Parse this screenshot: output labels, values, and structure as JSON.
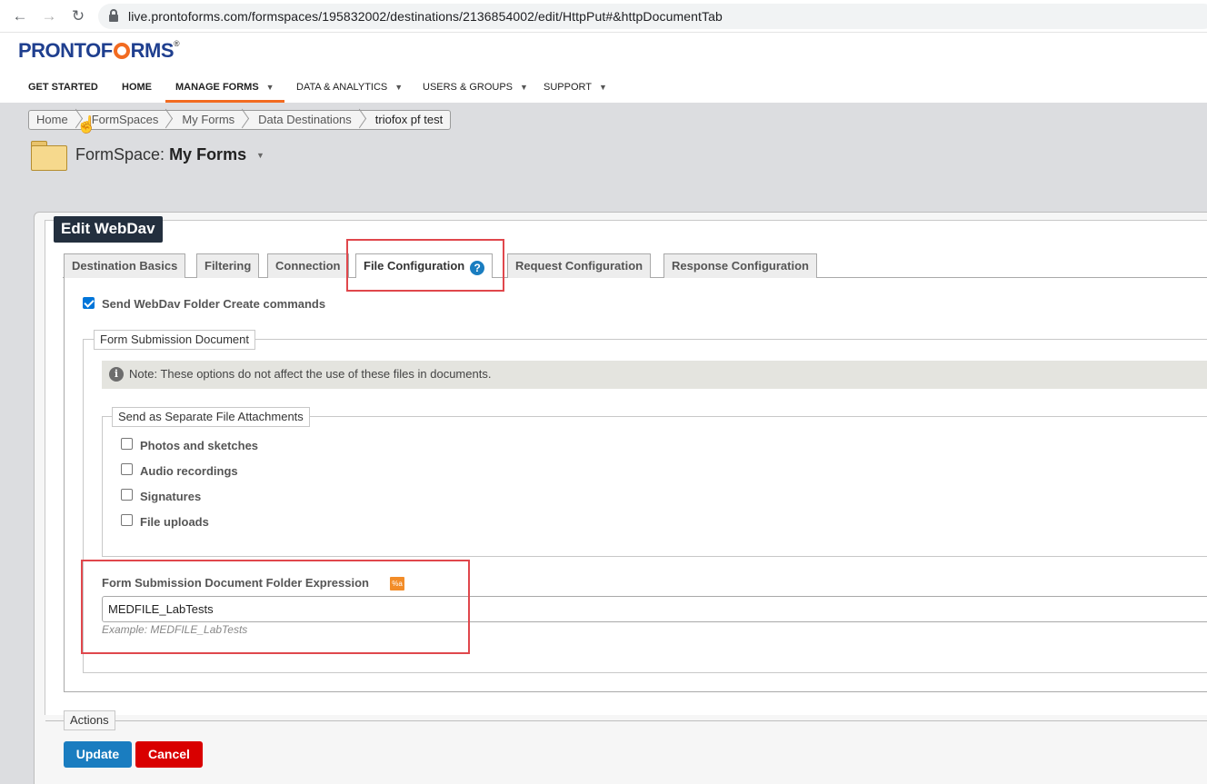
{
  "browser": {
    "url": "live.prontoforms.com/formspaces/195832002/destinations/2136854002/edit/HttpPut#&httpDocumentTab"
  },
  "header": {
    "logo_pre": "PRONTOF",
    "logo_post": "RMS",
    "logo_reg": "®",
    "nav": [
      {
        "label": "GET STARTED"
      },
      {
        "label": "HOME"
      },
      {
        "label": "MANAGE FORMS"
      },
      {
        "label": "DATA & ANALYTICS"
      },
      {
        "label": "USERS & GROUPS"
      },
      {
        "label": "SUPPORT"
      }
    ]
  },
  "breadcrumb": [
    "Home",
    "FormSpaces",
    "My Forms",
    "Data Destinations",
    "triofox pf test"
  ],
  "formspace": {
    "prefix": "FormSpace:",
    "name": "My Forms"
  },
  "panel": {
    "title": "Edit WebDav",
    "tabs": [
      {
        "label": "Destination Basics"
      },
      {
        "label": "Filtering"
      },
      {
        "label": "Connection"
      },
      {
        "label": "File Configuration"
      },
      {
        "label": "Request Configuration"
      },
      {
        "label": "Response Configuration"
      }
    ],
    "help_glyph": "?"
  },
  "file_config": {
    "send_folder_create_label": "Send WebDav Folder Create commands",
    "send_folder_create_checked": true,
    "form_submission_legend": "Form Submission Document",
    "note_text": "Note: These options do not affect the use of these files in documents.",
    "separate_legend": "Send as Separate File Attachments",
    "attachments": [
      {
        "label": "Photos and sketches",
        "checked": false
      },
      {
        "label": "Audio recordings",
        "checked": false
      },
      {
        "label": "Signatures",
        "checked": false
      },
      {
        "label": "File uploads",
        "checked": false
      }
    ],
    "folder_expression_label": "Form Submission Document Folder Expression",
    "folder_expression_badge": "%a",
    "folder_expression_value": "MEDFILE_LabTests",
    "folder_expression_example": "Example: MEDFILE_LabTests"
  },
  "actions": {
    "legend": "Actions",
    "update_label": "Update",
    "cancel_label": "Cancel"
  },
  "colors": {
    "accent_orange": "#f26b21",
    "logo_blue": "#1f3f8f",
    "update_blue": "#1a7dc0",
    "cancel_red": "#d90000",
    "highlight_red": "#e0474c"
  }
}
